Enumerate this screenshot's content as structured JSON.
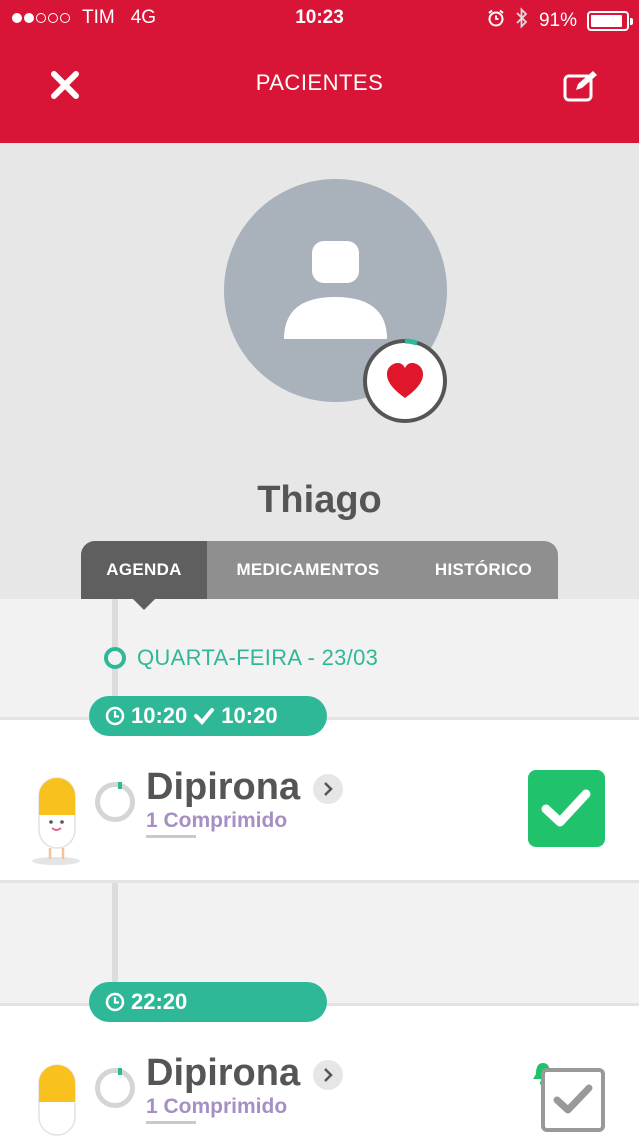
{
  "status_bar": {
    "carrier": "TIM",
    "network": "4G",
    "time": "10:23",
    "battery": "91%",
    "battery_fraction": 0.91,
    "signal_bars_filled": 2,
    "signal_bars_total": 5
  },
  "nav": {
    "title": "PACIENTES",
    "close_icon": "close-icon",
    "edit_icon": "edit-icon"
  },
  "profile": {
    "name": "Thiago",
    "avatar_icon": "person-icon",
    "badge_icon": "heart-icon"
  },
  "tabs": [
    {
      "label": "AGENDA",
      "active": true
    },
    {
      "label": "MEDICAMENTOS",
      "active": false
    },
    {
      "label": "HISTÓRICO",
      "active": false
    }
  ],
  "agenda": {
    "day_label": "QUARTA-FEIRA - 23/03",
    "entries": [
      {
        "scheduled_time": "10:20",
        "taken_time": "10:20",
        "medicine": "Dipirona",
        "dose": "1 Comprimido",
        "status": "taken"
      },
      {
        "scheduled_time": "22:20",
        "medicine": "Dipirona",
        "dose": "1 Comprimido",
        "status": "pending"
      }
    ]
  },
  "colors": {
    "header": "#d81537",
    "accent_green": "#2fb897",
    "done_green": "#20c36b",
    "dose_purple": "#a58fc4"
  }
}
